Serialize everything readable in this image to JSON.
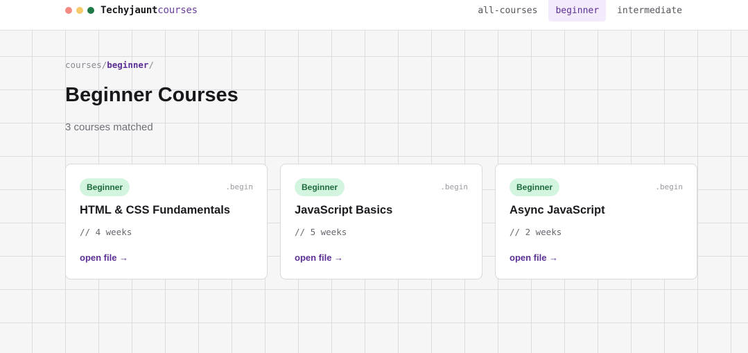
{
  "header": {
    "brand_name": "Techyjaunt",
    "brand_accent": "courses",
    "window_dots": [
      {
        "name": "red-dot",
        "color": "#f28b82"
      },
      {
        "name": "yellow-dot",
        "color": "#f6c96b"
      },
      {
        "name": "green-dot",
        "color": "#1e7a46"
      }
    ],
    "nav": [
      {
        "label": "all-courses",
        "active": false
      },
      {
        "label": "beginner",
        "active": true
      },
      {
        "label": "intermediate",
        "active": false
      }
    ]
  },
  "breadcrumb": {
    "root": "courses",
    "separator": "/",
    "current": "beginner",
    "trailing": "/"
  },
  "page": {
    "title": "Beginner Courses",
    "subtitle": "3 courses matched"
  },
  "courses": [
    {
      "level": "Beginner",
      "tag": ".begin",
      "title": "HTML & CSS Fundamentals",
      "duration": "// 4 weeks",
      "link": "open file →"
    },
    {
      "level": "Beginner",
      "tag": ".begin",
      "title": "JavaScript Basics",
      "duration": "// 5 weeks",
      "link": "open file →"
    },
    {
      "level": "Beginner",
      "tag": ".begin",
      "title": "Async JavaScript",
      "duration": "// 2 weeks",
      "link": "open file →"
    }
  ],
  "colors": {
    "accent": "#5b2f94",
    "badge_bg": "#d3f5df",
    "badge_text": "#1d6b3c"
  }
}
